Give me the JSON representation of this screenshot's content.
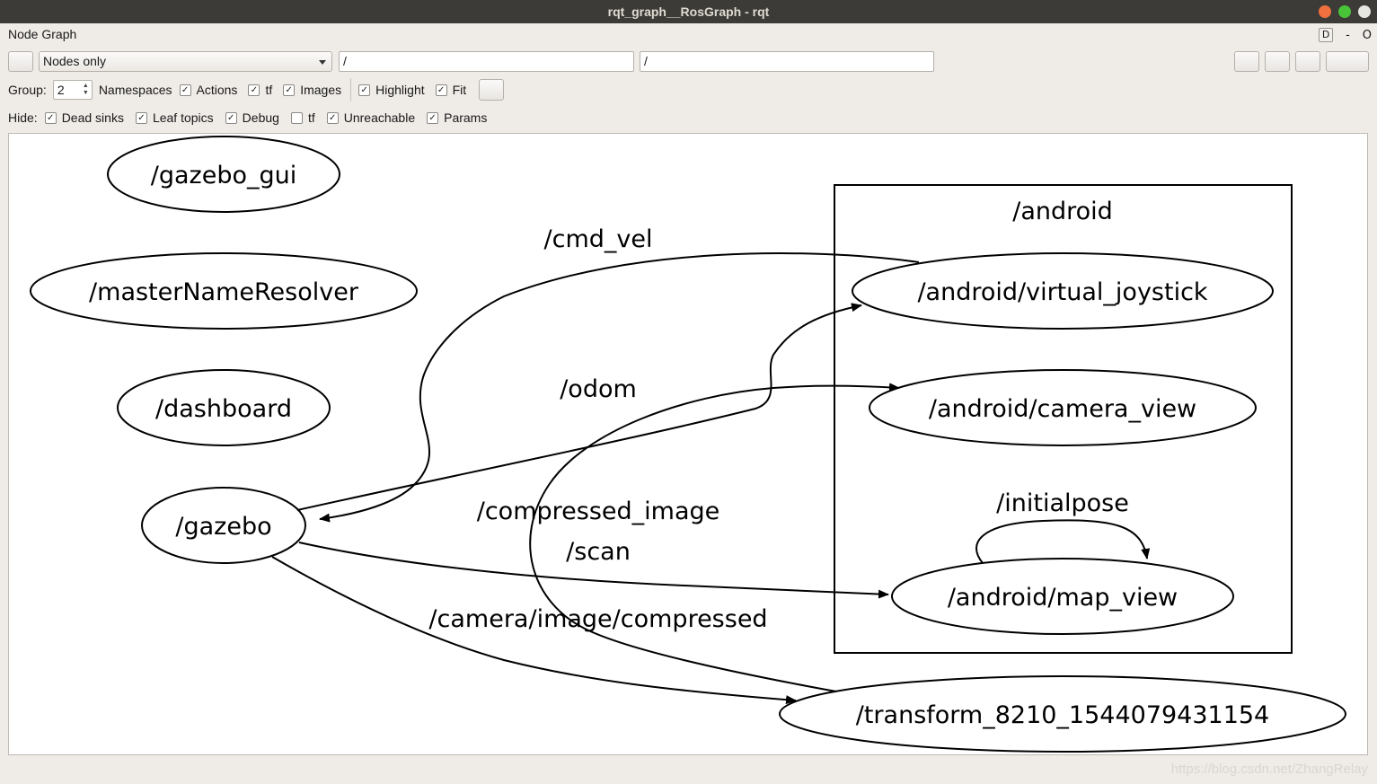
{
  "window": {
    "title": "rqt_graph__RosGraph - rqt"
  },
  "panel": {
    "title": "Node Graph",
    "dock_d": "D",
    "dock_minus": "-",
    "dock_close": "O"
  },
  "toolbar": {
    "mode_selected": "Nodes only",
    "filter_left": "/",
    "filter_right": "/"
  },
  "options": {
    "group_label": "Group:",
    "group_value": "2",
    "namespaces_label": "Namespaces",
    "actions": {
      "label": "Actions",
      "checked": true
    },
    "tf": {
      "label": "tf",
      "checked": true
    },
    "images": {
      "label": "Images",
      "checked": true
    },
    "highlight": {
      "label": "Highlight",
      "checked": true
    },
    "fit": {
      "label": "Fit",
      "checked": true
    }
  },
  "hide": {
    "label": "Hide:",
    "dead_sinks": {
      "label": "Dead sinks",
      "checked": true
    },
    "leaf_topics": {
      "label": "Leaf topics",
      "checked": true
    },
    "debug": {
      "label": "Debug",
      "checked": true
    },
    "tf": {
      "label": "tf",
      "checked": false
    },
    "unreachable": {
      "label": "Unreachable",
      "checked": true
    },
    "params": {
      "label": "Params",
      "checked": true
    }
  },
  "graph": {
    "cluster": "/android",
    "nodes": {
      "gazebo_gui": "/gazebo_gui",
      "master_name_resolver": "/masterNameResolver",
      "dashboard": "/dashboard",
      "gazebo": "/gazebo",
      "virtual_joystick": "/android/virtual_joystick",
      "camera_view": "/android/camera_view",
      "map_view": "/android/map_view",
      "transform": "/transform_8210_1544079431154"
    },
    "edges": {
      "cmd_vel": "/cmd_vel",
      "odom": "/odom",
      "compressed_image": "/compressed_image",
      "scan": "/scan",
      "camera_image_compressed": "/camera/image/compressed",
      "initialpose": "/initialpose"
    }
  },
  "watermark": "https://blog.csdn.net/ZhangRelay"
}
